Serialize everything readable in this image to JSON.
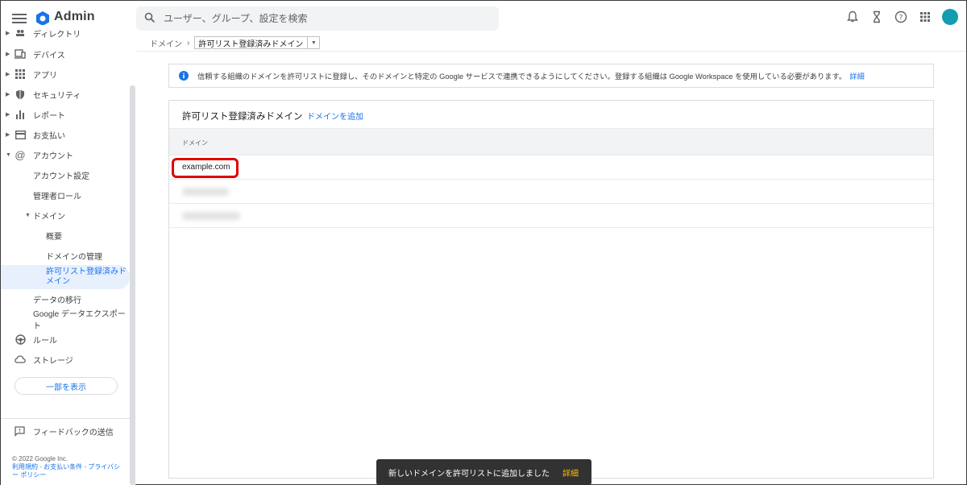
{
  "header": {
    "app_title": "Admin",
    "search_placeholder": "ユーザー、グループ、設定を検索",
    "icons": [
      "menu-icon",
      "admin-logo",
      "search-icon",
      "bell-icon",
      "hourglass-icon",
      "help-icon",
      "apps-icon",
      "avatar"
    ],
    "avatar_color": "#129eaf"
  },
  "sidebar": {
    "items": [
      {
        "label": "ディレクトリ",
        "icon": "directory-icon"
      },
      {
        "label": "デバイス",
        "icon": "devices-icon"
      },
      {
        "label": "アプリ",
        "icon": "apps-grid-icon"
      },
      {
        "label": "セキュリティ",
        "icon": "shield-icon"
      },
      {
        "label": "レポート",
        "icon": "bar-chart-icon"
      },
      {
        "label": "お支払い",
        "icon": "credit-card-icon"
      },
      {
        "label": "アカウント",
        "icon": "at-icon"
      },
      {
        "label": "アカウント設定"
      },
      {
        "label": "管理者ロール"
      },
      {
        "label": "ドメイン"
      },
      {
        "label": "概要"
      },
      {
        "label": "ドメインの管理"
      },
      {
        "label": "許可リスト登録済みドメイン"
      },
      {
        "label": "データの移行"
      },
      {
        "label": "Google データエクスポート"
      },
      {
        "label": "ルール",
        "icon": "rules-icon"
      },
      {
        "label": "ストレージ",
        "icon": "cloud-icon"
      }
    ],
    "show_less": "一部を表示",
    "feedback": "フィードバックの送信",
    "copyright": "© 2022 Google Inc.",
    "footer_links": "利用規約 - お支払い条件 - プライバシー ポリシー"
  },
  "breadcrumb": {
    "parent": "ドメイン",
    "separator": "›",
    "current": "許可リスト登録済みドメイン"
  },
  "info_banner": {
    "text": "信頼する組織のドメインを許可リストに登録し、そのドメインと特定の Google サービスで連携できるようにしてください。登録する組織は Google Workspace を使用している必要があります。",
    "link": "詳細"
  },
  "card": {
    "title": "許可リスト登録済みドメイン",
    "add_link": "ドメインを追加",
    "column_header": "ドメイン",
    "rows": [
      {
        "domain": "example.com"
      }
    ]
  },
  "snackbar": {
    "message": "新しいドメインを許可リストに追加しました",
    "action": "詳細"
  },
  "colors": {
    "accent": "#1a73e8",
    "highlight": "#e00000",
    "snackbar_action": "#fbbc04"
  }
}
